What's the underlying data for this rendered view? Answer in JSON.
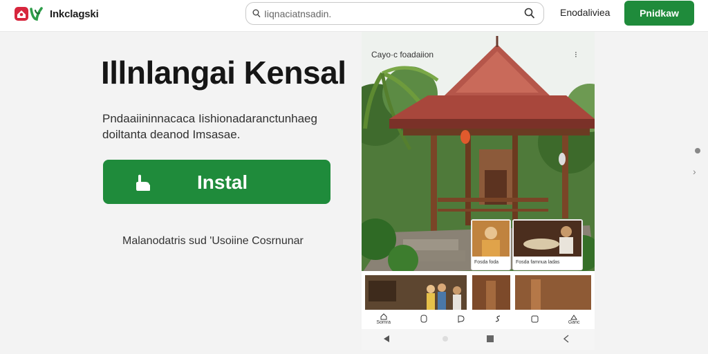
{
  "header": {
    "brand": "Inkclagski",
    "search": {
      "placeholder": "Iiqnaciatnsadin.",
      "value": ""
    },
    "nav_link": "Enodaliviea",
    "cta": "Pnidkaw"
  },
  "hero": {
    "title": "Illnlangai Kensal",
    "description": "Pndaaiininnacaca Iishionadaranctunhaeg doiltanta deanod Imsasae.",
    "install_label": "Instal",
    "note": "Malanodatris sud 'Usoiine Cosrnunar"
  },
  "phone": {
    "title": "Cayo·c foadaiion",
    "menu_icon": "more-vertical-icon",
    "cards": [
      {
        "caption": "Fosda foda"
      },
      {
        "caption": "Fosda famnua ladas"
      }
    ],
    "tabs": [
      {
        "label": "Somra",
        "icon": "home-icon"
      },
      {
        "label": "",
        "icon": "chat-icon"
      },
      {
        "label": "",
        "icon": "message-icon"
      },
      {
        "label": "",
        "icon": "share-icon"
      },
      {
        "label": "",
        "icon": "tag-icon"
      },
      {
        "label": "Ganc",
        "icon": "account-icon"
      }
    ],
    "sysnav": [
      "back-icon",
      "home-button-icon",
      "recents-icon",
      "return-icon"
    ]
  },
  "colors": {
    "accent": "#1f8b3b",
    "logo_red": "#d7263d",
    "logo_green": "#2e9d4a",
    "background": "#f3f3f3"
  }
}
